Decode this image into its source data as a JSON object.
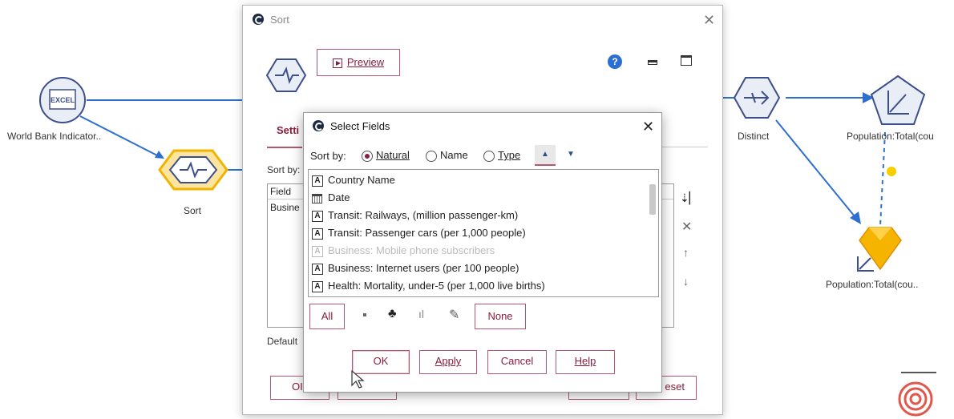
{
  "canvas": {
    "nodes": {
      "world_bank": {
        "label": "World Bank Indicator..",
        "icon_text": "EXCEL"
      },
      "sort": {
        "label": "Sort"
      },
      "distinct": {
        "label": "Distinct"
      },
      "plot": {
        "label": "Population:Total(cou"
      },
      "model": {
        "label": "Population:Total(cou.."
      }
    }
  },
  "sort_dialog": {
    "title": "Sort",
    "preview_label": "Preview",
    "tab_settings": "Setti",
    "sort_by_label": "Sort by:",
    "table_header": "Field",
    "table_row": "Busine",
    "default_label": "Default",
    "ok_partial": "OI",
    "reset_partial": "eset"
  },
  "select_fields": {
    "title": "Select Fields",
    "sort_by_label": "Sort by:",
    "sort_options": [
      {
        "label": "Natural",
        "selected": true
      },
      {
        "label": "Name",
        "selected": false
      },
      {
        "label": "Type",
        "selected": false
      }
    ],
    "fields": [
      {
        "type": "A",
        "name": "Country Name",
        "enabled": true
      },
      {
        "type": "date",
        "name": "Date",
        "enabled": true
      },
      {
        "type": "A",
        "name": "Transit: Railways, (million passenger-km)",
        "enabled": true
      },
      {
        "type": "A",
        "name": "Transit: Passenger cars (per 1,000 people)",
        "enabled": true
      },
      {
        "type": "A",
        "name": "Business: Mobile phone subscribers",
        "enabled": false
      },
      {
        "type": "A",
        "name": "Business: Internet users (per 100 people)",
        "enabled": true
      },
      {
        "type": "A",
        "name": "Health: Mortality, under-5 (per 1,000 live births)",
        "enabled": true
      }
    ],
    "all_label": "All",
    "none_label": "None",
    "ok_label": "OK",
    "apply_label": "Apply",
    "cancel_label": "Cancel",
    "help_label": "Help"
  },
  "colors": {
    "accent": "#8a1c3c",
    "link": "#1f5fbf",
    "node_yellow": "#f5b400"
  }
}
